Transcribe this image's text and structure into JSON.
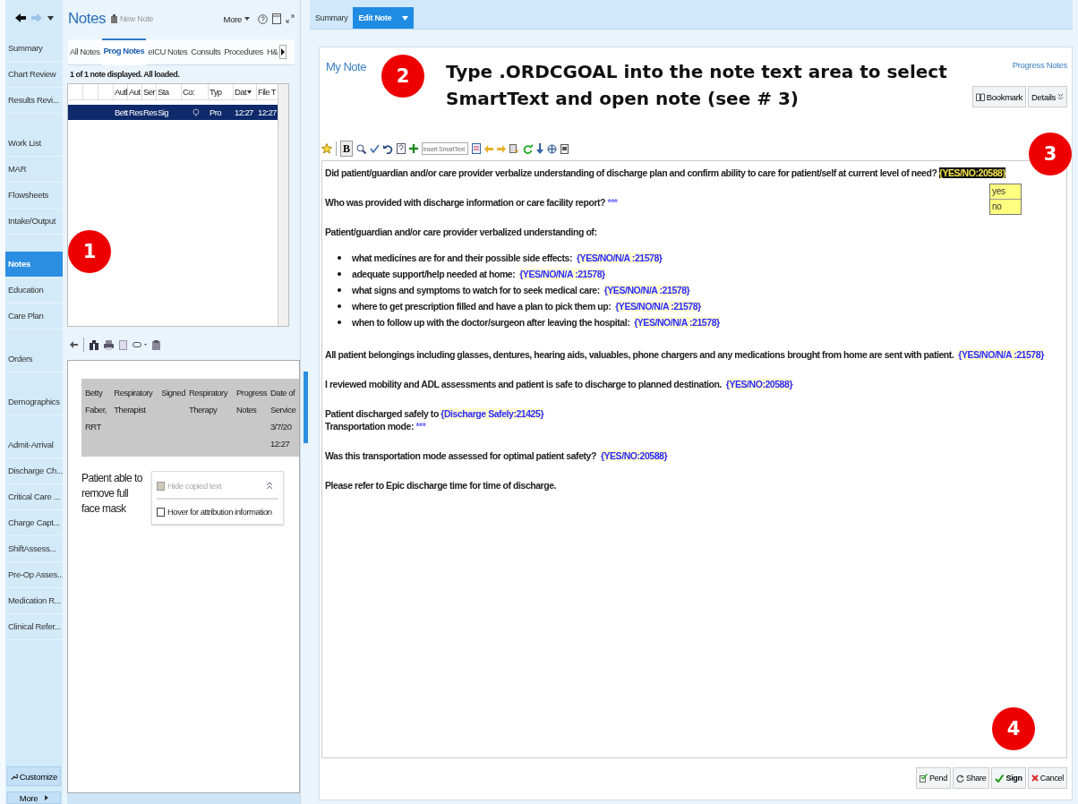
{
  "sidebar": {
    "groups": [
      [
        {
          "label": "Summary",
          "selected": false
        },
        {
          "label": "Chart Review",
          "selected": false
        },
        {
          "label": "Results Revi...",
          "selected": false
        }
      ],
      [
        {
          "label": "Work List",
          "selected": false
        },
        {
          "label": "MAR",
          "selected": false
        },
        {
          "label": "Flowsheets",
          "selected": false
        },
        {
          "label": "Intake/Output",
          "selected": false
        }
      ],
      [
        {
          "label": "Notes",
          "selected": true
        },
        {
          "label": "Education",
          "selected": false
        },
        {
          "label": "Care Plan",
          "selected": false
        }
      ],
      [
        {
          "label": "Orders",
          "selected": false
        }
      ],
      [
        {
          "label": "Demographics",
          "selected": false
        }
      ],
      [
        {
          "label": "Admit-Arrival",
          "selected": false
        },
        {
          "label": "Discharge Ch...",
          "selected": false
        },
        {
          "label": "Critical Care ...",
          "selected": false
        },
        {
          "label": "Charge Capt...",
          "selected": false
        },
        {
          "label": "ShiftAssess...",
          "selected": false
        },
        {
          "label": "Pre-Op Asses...",
          "selected": false
        },
        {
          "label": "Medication R...",
          "selected": false
        },
        {
          "label": "Clinical Refer...",
          "selected": false
        }
      ]
    ],
    "customize": "Customize",
    "more": "More"
  },
  "notes_panel": {
    "title": "Notes",
    "new_note": {
      "label": "New Note",
      "disabled": true
    },
    "more": "More",
    "tabs": [
      {
        "label": "All Notes",
        "selected": false
      },
      {
        "label": "Prog Notes",
        "selected": true
      },
      {
        "label": "eICU Notes",
        "selected": false
      },
      {
        "label": "Consults",
        "selected": false
      },
      {
        "label": "Procedures",
        "selected": false
      },
      {
        "label": "H&",
        "selected": false
      }
    ],
    "status": "1 of 1 note displayed. All loaded.",
    "table": {
      "columns": [
        {
          "label": "Autl",
          "sorted": false
        },
        {
          "label": "Aut",
          "sorted": false
        },
        {
          "label": "Ser",
          "sorted": false
        },
        {
          "label": "Sta",
          "sorted": false
        },
        {
          "label": "Co:",
          "sorted": false
        },
        {
          "label": "Typ",
          "sorted": false
        },
        {
          "label": "Dat",
          "sorted": true
        },
        {
          "label": "File T",
          "sorted": false
        }
      ],
      "rows": [
        {
          "selected": true,
          "cells": [
            {
              "kind": "text",
              "text": "Bett"
            },
            {
              "kind": "text",
              "text": "Res"
            },
            {
              "kind": "text",
              "text": "Res"
            },
            {
              "kind": "text",
              "text": "Sig"
            },
            {
              "kind": "icon"
            },
            {
              "kind": "text",
              "text": "Pro"
            },
            {
              "kind": "text",
              "text": "12:27"
            },
            {
              "kind": "text",
              "text": "12:27"
            }
          ]
        }
      ]
    },
    "preview": {
      "header": [
        "Betty Faber, RRT",
        "Respiratory Therapist",
        "Signed",
        "Respiratory Therapy",
        "Progress Notes",
        "Date of Service 3/7/20 12:27"
      ],
      "body": "Patient able to remove full face mask",
      "options": [
        {
          "label": "Hide copied text",
          "checked": false,
          "disabled": true
        },
        {
          "label": "Hover for attribution information",
          "checked": false,
          "disabled": false
        }
      ]
    }
  },
  "main_tabs": [
    {
      "label": "Summary",
      "selected": false
    },
    {
      "label": "Edit Note",
      "selected": true
    }
  ],
  "note": {
    "title": "My Note",
    "type": "Progress Notes",
    "bookmark": "Bookmark",
    "details": "Details",
    "bold_button": "B",
    "smarttext_placeholder": "Insert SmartText",
    "body": [
      {
        "kind": "para",
        "lines": [
          [
            {
              "kind": "text",
              "text": "Did patient/guardian and/or care provider verbalize understanding of discharge plan and confirm ability to care for patient/self at current level of need? "
            },
            {
              "kind": "smartlist",
              "text": "{YES/NO:20588}",
              "selected": true
            }
          ]
        ]
      },
      {
        "kind": "para",
        "lines": [
          [
            {
              "kind": "text",
              "text": "Who was provided with discharge information or care facility report? "
            },
            {
              "kind": "wildcard",
              "text": "***"
            }
          ]
        ]
      },
      {
        "kind": "para",
        "lines": [
          [
            {
              "kind": "text",
              "text": "Patient/guardian and/or care provider verbalized understanding of:"
            }
          ]
        ]
      },
      {
        "kind": "list",
        "lines": [
          [
            {
              "kind": "text",
              "text": "what medicines are for and their possible side effects:  "
            },
            {
              "kind": "smartlist",
              "text": "{YES/NO/N/A :21578}",
              "selected": false
            }
          ],
          [
            {
              "kind": "text",
              "text": "adequate support/help needed at home:  "
            },
            {
              "kind": "smartlist",
              "text": "{YES/NO/N/A :21578}",
              "selected": false
            }
          ],
          [
            {
              "kind": "text",
              "text": "what signs and symptoms to watch for to seek medical care:  "
            },
            {
              "kind": "smartlist",
              "text": "{YES/NO/N/A :21578}",
              "selected": false
            }
          ],
          [
            {
              "kind": "text",
              "text": "where to get prescription filled and have a plan to pick them up:  "
            },
            {
              "kind": "smartlist",
              "text": "{YES/NO/N/A :21578}",
              "selected": false
            }
          ],
          [
            {
              "kind": "text",
              "text": "when to follow up with the doctor/surgeon after leaving the hospital:  "
            },
            {
              "kind": "smartlist",
              "text": "{YES/NO/N/A :21578}",
              "selected": false
            }
          ]
        ]
      },
      {
        "kind": "para",
        "lines": [
          [
            {
              "kind": "text",
              "text": "All patient belongings including glasses, dentures, hearing aids, valuables, phone chargers and any medications brought from home are sent with patient.  "
            },
            {
              "kind": "smartlist",
              "text": "{YES/NO/N/A :21578}",
              "selected": false
            }
          ]
        ]
      },
      {
        "kind": "para",
        "lines": [
          [
            {
              "kind": "text",
              "text": "I reviewed mobility and ADL assessments and patient is safe to discharge to planned destination.  "
            },
            {
              "kind": "smartlist",
              "text": "{YES/NO:20588}",
              "selected": false
            }
          ]
        ]
      },
      {
        "kind": "para",
        "lines": [
          [
            {
              "kind": "text",
              "text": "Patient discharged safely to "
            },
            {
              "kind": "smartlist",
              "text": "{Discharge Safely:21425}",
              "selected": false
            }
          ],
          [
            {
              "kind": "text",
              "text": "Transportation mode: "
            },
            {
              "kind": "wildcard",
              "text": "***"
            }
          ]
        ]
      },
      {
        "kind": "para",
        "lines": [
          [
            {
              "kind": "text",
              "text": "Was this transportation mode assessed for optimal patient safety?  "
            },
            {
              "kind": "smartlist",
              "text": "{YES/NO:20588}",
              "selected": false
            }
          ]
        ]
      },
      {
        "kind": "para",
        "lines": [
          [
            {
              "kind": "text",
              "text": "Please refer to Epic discharge time for time of discharge."
            }
          ]
        ]
      }
    ],
    "dropdown": [
      "yes",
      "no"
    ],
    "buttons": [
      {
        "kind": "pend",
        "label": "Pend"
      },
      {
        "kind": "share",
        "label": "Share"
      },
      {
        "kind": "sign",
        "label": "Sign"
      },
      {
        "kind": "cancel",
        "label": "Cancel"
      }
    ]
  },
  "annotations": {
    "callouts": [
      "1",
      "2",
      "3",
      "4"
    ],
    "instruction": "Type .ORDCGOAL into the note text area to select SmartText and open note (see # 3)"
  }
}
